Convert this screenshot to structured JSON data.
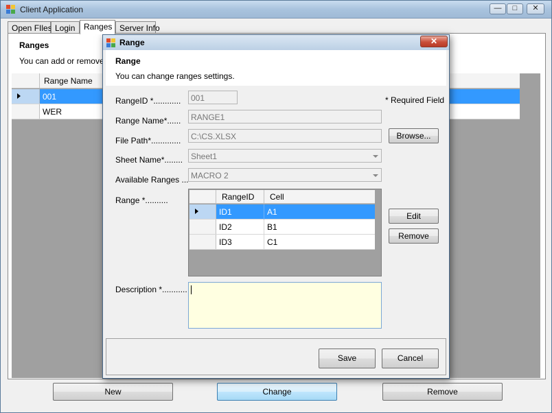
{
  "window": {
    "title": "Client Application",
    "controls": {
      "minimize": "—",
      "maximize": "□",
      "close": "✕"
    }
  },
  "tabs": [
    {
      "label": "Open FIles",
      "active": false
    },
    {
      "label": "Login",
      "active": false
    },
    {
      "label": "Ranges",
      "active": true
    },
    {
      "label": "Server Info",
      "active": false
    }
  ],
  "ranges_panel": {
    "title": "Ranges",
    "description": "You can add or  remove R",
    "grid": {
      "column_header": "Range Name",
      "rows": [
        {
          "value": "001",
          "selected": true
        },
        {
          "value": "WER",
          "selected": false
        }
      ]
    }
  },
  "bottom_buttons": {
    "new": "New",
    "change": "Change",
    "remove": "Remove"
  },
  "dialog": {
    "title": "Range",
    "close": "✕",
    "header_title": "Range",
    "header_description": "You can change ranges settings.",
    "required_note": "* Required Field",
    "labels": {
      "range_id": "RangeID *............",
      "range_name": "Range Name*......",
      "file_path": "File Path*.............",
      "sheet_name": "Sheet Name*........",
      "available_ranges": "Available Ranges ...",
      "range": "Range *..........",
      "description": "Description *..........."
    },
    "values": {
      "range_id": "001",
      "range_name": "RANGE1",
      "file_path": "C:\\CS.XLSX",
      "sheet_name": "Sheet1",
      "available_ranges": "MACRO 2",
      "description": ""
    },
    "range_grid": {
      "columns": [
        "RangeID",
        "Cell"
      ],
      "rows": [
        {
          "id": "ID1",
          "cell": "A1",
          "selected": true
        },
        {
          "id": "ID2",
          "cell": "B1",
          "selected": false
        },
        {
          "id": "ID3",
          "cell": "C1",
          "selected": false
        }
      ]
    },
    "buttons": {
      "browse": "Browse...",
      "edit": "Edit",
      "remove": "Remove",
      "save": "Save",
      "cancel": "Cancel"
    }
  },
  "colors": {
    "selection": "#3399ff",
    "description_bg": "#ffffe1",
    "title_bar": "#b9cfe6"
  }
}
